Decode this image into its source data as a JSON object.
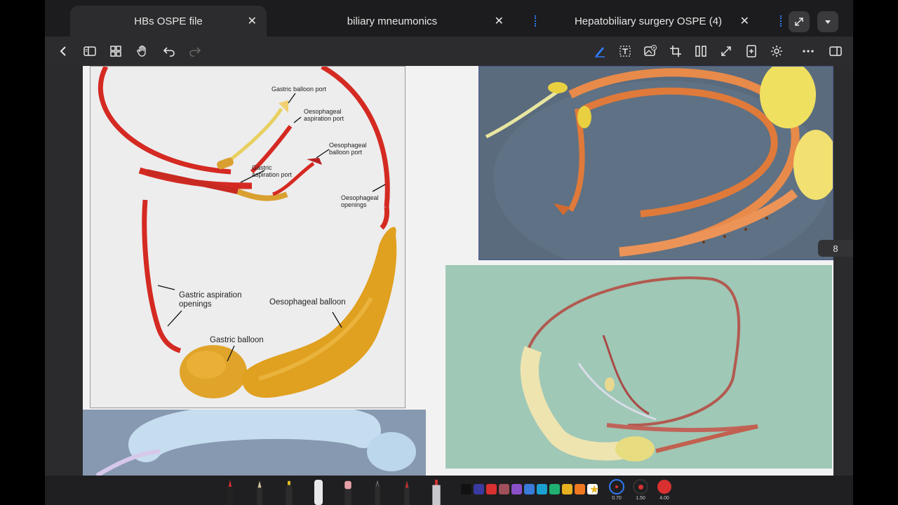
{
  "tabs": [
    {
      "title": "HBs OSPE file",
      "active": true
    },
    {
      "title": "biliary mneumonics",
      "active": false
    },
    {
      "title": "Hepatobiliary surgery OSPE  (4)",
      "active": false
    }
  ],
  "tab_close_symbol": "✕",
  "toolbar": {
    "left_icons": [
      "back-chevron-icon",
      "sidebar-toggle-icon",
      "grid-view-icon",
      "hand-pan-icon",
      "undo-icon",
      "redo-icon"
    ],
    "right_icons": [
      "pen-icon",
      "text-box-icon",
      "image-insert-icon",
      "crop-icon",
      "column-split-icon",
      "expand-icon",
      "add-page-icon",
      "settings-icon",
      "more-icon",
      "reader-view-icon"
    ]
  },
  "page_number": "8",
  "diagram_labels": {
    "gastric_balloon_port": "Gastric balloon port",
    "oesophageal_aspiration_port": "Oesophageal\naspiration port",
    "oesophageal_balloon_port": "Oesophageal\nballoon port",
    "gastric_aspiration_port": "Gastric\naspiration port",
    "oesophageal_openings": "Oesophageal\nopenings",
    "gastric_aspiration_openings": "Gastric aspiration\nopenings",
    "oesophageal_balloon": "Oesophageal balloon",
    "gastric_balloon": "Gastric balloon"
  },
  "palette_colors": [
    "#111111",
    "#3a3aa0",
    "#d93030",
    "#a0505a",
    "#8a50c8",
    "#3a7ad8",
    "#1aa0d0",
    "#20b070",
    "#e8b020",
    "#f07820",
    "#ffffff"
  ],
  "accent": "#2f7bf6",
  "brush_sizes": [
    "0.70",
    "1.50",
    "4.00"
  ]
}
